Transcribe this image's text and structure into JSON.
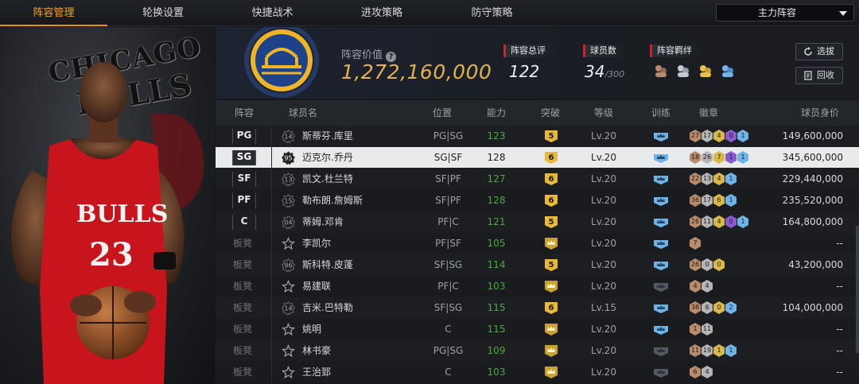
{
  "tabs": [
    "阵容管理",
    "轮换设置",
    "快捷战术",
    "进攻策略",
    "防守策略"
  ],
  "active_tab": 0,
  "lineup_select": "主力阵容",
  "left_art": {
    "word1": "CHICAGO",
    "word2": "BULLS"
  },
  "header": {
    "value_label": "阵容价值",
    "value": "1,272,160,000",
    "rating_label": "阵容总评",
    "rating": "122",
    "count_label": "球员数",
    "count": "34",
    "count_max": "/300",
    "synergy_label": "阵容羁绊",
    "btn_select": "选拔",
    "btn_return": "回收"
  },
  "columns": [
    "阵容",
    "球员名",
    "位置",
    "能力",
    "突破",
    "等级",
    "训练",
    "徽章",
    "球员身价"
  ],
  "rows": [
    {
      "slot": "PG",
      "number": "14",
      "name": "斯蒂芬.库里",
      "pos": "PG|SG",
      "ability": "123",
      "green": true,
      "breakthrough": "5",
      "level": "Lv.20",
      "badges": [
        [
          "27",
          "#b98b6a"
        ],
        [
          "17",
          "#b5b5b5"
        ],
        [
          "4",
          "#d8b94a"
        ],
        [
          "0",
          "#8a5bd0"
        ],
        [
          "1",
          "#6fb4e8"
        ]
      ],
      "price": "149,600,000"
    },
    {
      "slot": "SG",
      "number": "95",
      "name": "迈克尔.乔丹",
      "pos": "SG|SF",
      "ability": "128",
      "green": false,
      "breakthrough": "6",
      "level": "Lv.20",
      "badges": [
        [
          "18",
          "#b98b6a"
        ],
        [
          "26",
          "#b5b5b5"
        ],
        [
          "7",
          "#d8b94a"
        ],
        [
          "1",
          "#8a5bd0"
        ],
        [
          "1",
          "#6fb4e8"
        ]
      ],
      "price": "345,600,000",
      "selected": true
    },
    {
      "slot": "SF",
      "number": "13",
      "name": "凯文.杜兰特",
      "pos": "SF|PF",
      "ability": "127",
      "green": true,
      "breakthrough": "6",
      "level": "Lv.20",
      "badges": [
        [
          "22",
          "#b98b6a"
        ],
        [
          "13",
          "#b5b5b5"
        ],
        [
          "4",
          "#d8b94a"
        ],
        [
          "1",
          "#6fb4e8"
        ]
      ],
      "price": "229,440,000"
    },
    {
      "slot": "PF",
      "number": "15",
      "name": "勒布朗.詹姆斯",
      "pos": "SF|PF",
      "ability": "128",
      "green": true,
      "breakthrough": "6",
      "level": "Lv.20",
      "badges": [
        [
          "36",
          "#b98b6a"
        ],
        [
          "17",
          "#b5b5b5"
        ],
        [
          "6",
          "#d8b94a"
        ],
        [
          "1",
          "#6fb4e8"
        ]
      ],
      "price": "235,520,000"
    },
    {
      "slot": "C",
      "number": "04",
      "name": "蒂姆.邓肯",
      "pos": "PF|C",
      "ability": "121",
      "green": true,
      "breakthrough": "5",
      "level": "Lv.20",
      "badges": [
        [
          "26",
          "#b98b6a"
        ],
        [
          "11",
          "#b5b5b5"
        ],
        [
          "4",
          "#d8b94a"
        ],
        [
          "0",
          "#8a5bd0"
        ],
        [
          "1",
          "#6fb4e8"
        ]
      ],
      "price": "164,800,000"
    },
    {
      "slot": "板凳",
      "number": "",
      "name": "李凯尔",
      "pos": "PF|SF",
      "ability": "105",
      "green": true,
      "breakthrough": "",
      "level": "Lv.20",
      "badges": [
        [
          "7",
          "#b98b6a"
        ]
      ],
      "price": "--"
    },
    {
      "slot": "板凳",
      "number": "96",
      "name": "斯科特.皮蓬",
      "pos": "SF|SG",
      "ability": "114",
      "green": true,
      "breakthrough": "5",
      "level": "Lv.20",
      "badges": [
        [
          "26",
          "#b98b6a"
        ],
        [
          "0",
          "#b5b5b5"
        ],
        [
          "0",
          "#d8b94a"
        ]
      ],
      "price": "43,200,000"
    },
    {
      "slot": "板凳",
      "number": "",
      "name": "易建联",
      "pos": "PF|C",
      "ability": "103",
      "green": true,
      "breakthrough": "",
      "level": "Lv.20",
      "badges": [
        [
          "4",
          "#b98b6a"
        ],
        [
          "4",
          "#b5b5b5"
        ]
      ],
      "price": "--"
    },
    {
      "slot": "板凳",
      "number": "14",
      "name": "吉米.巴特勒",
      "pos": "SF|SG",
      "ability": "115",
      "green": true,
      "breakthrough": "6",
      "level": "Lv.15",
      "badges": [
        [
          "38",
          "#b98b6a"
        ],
        [
          "6",
          "#b5b5b5"
        ],
        [
          "0",
          "#d8b94a"
        ],
        [
          "2",
          "#6fb4e8"
        ]
      ],
      "price": "104,000,000"
    },
    {
      "slot": "板凳",
      "number": "",
      "name": "姚明",
      "pos": "C",
      "ability": "115",
      "green": true,
      "breakthrough": "",
      "level": "Lv.20",
      "badges": [
        [
          "1",
          "#b98b6a"
        ],
        [
          "11",
          "#b5b5b5"
        ]
      ],
      "price": "--"
    },
    {
      "slot": "板凳",
      "number": "",
      "name": "林书豪",
      "pos": "PG|SG",
      "ability": "109",
      "green": true,
      "breakthrough": "",
      "level": "Lv.20",
      "badges": [
        [
          "11",
          "#b98b6a"
        ],
        [
          "19",
          "#b5b5b5"
        ],
        [
          "1",
          "#d8b94a"
        ],
        [
          "1",
          "#6fb4e8"
        ]
      ],
      "price": "--"
    },
    {
      "slot": "板凳",
      "number": "",
      "name": "王治郅",
      "pos": "C",
      "ability": "103",
      "green": true,
      "breakthrough": "",
      "level": "Lv.20",
      "badges": [
        [
          "6",
          "#b98b6a"
        ],
        [
          "4",
          "#b5b5b5"
        ]
      ],
      "price": "--"
    }
  ]
}
